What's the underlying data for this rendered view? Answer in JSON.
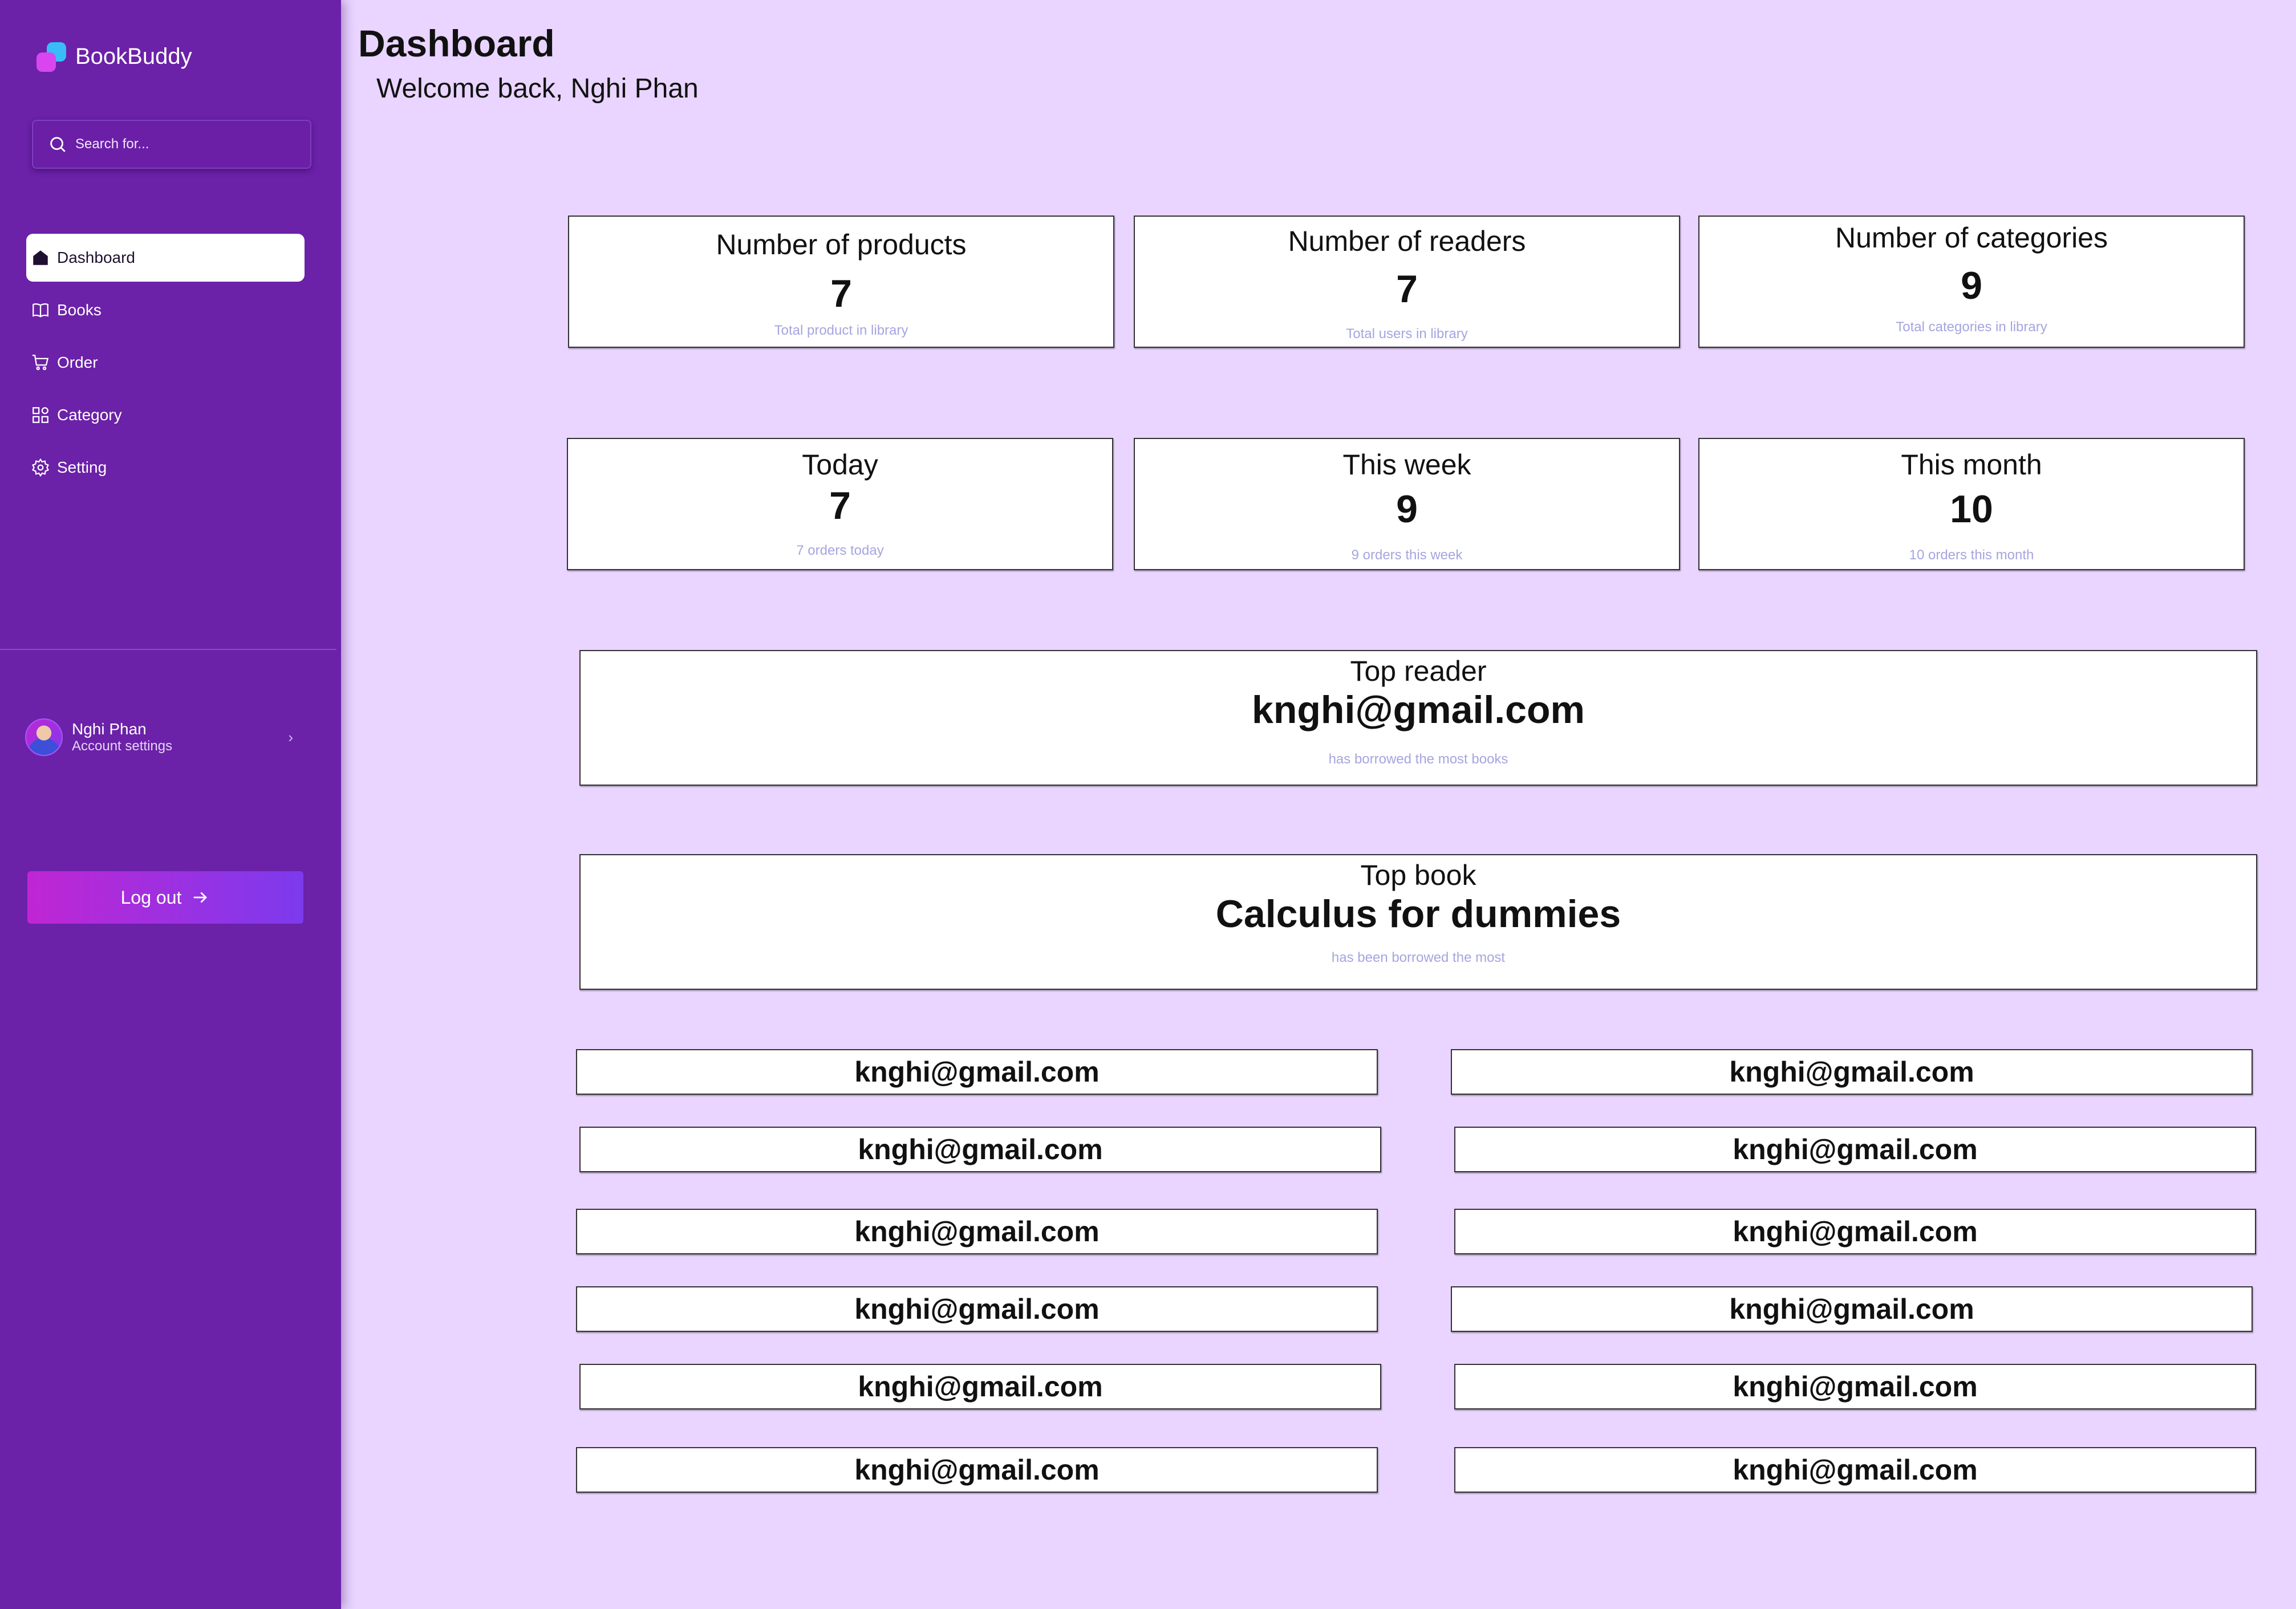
{
  "app": {
    "name": "BookBuddy"
  },
  "search": {
    "placeholder": "Search for..."
  },
  "nav": {
    "items": [
      {
        "label": "Dashboard",
        "icon": "home-icon",
        "active": true
      },
      {
        "label": "Books",
        "icon": "book-icon"
      },
      {
        "label": "Order",
        "icon": "cart-icon"
      },
      {
        "label": "Category",
        "icon": "grid-icon"
      },
      {
        "label": "Setting",
        "icon": "gear-icon"
      }
    ]
  },
  "profile": {
    "name": "Nghi Phan",
    "subtitle": "Account settings",
    "chevron": "›"
  },
  "logout": {
    "label": "Log out"
  },
  "header": {
    "title": "Dashboard",
    "welcome": "Welcome back, Nghi Phan"
  },
  "stats": [
    {
      "title": "Number of products",
      "value": "7",
      "sub": "Total product in library"
    },
    {
      "title": "Number of readers",
      "value": "7",
      "sub": "Total users in library"
    },
    {
      "title": "Number of  categories",
      "value": "9",
      "sub": "Total categories in library"
    }
  ],
  "orders": [
    {
      "title": "Today",
      "value": "7",
      "sub": "7 orders today"
    },
    {
      "title": "This week",
      "value": "9",
      "sub": "9 orders this week"
    },
    {
      "title": "This month",
      "value": "10",
      "sub": "10 orders this month"
    }
  ],
  "top_reader": {
    "title": "Top reader",
    "value": "knghi@gmail.com",
    "sub": "has borrowed the most books"
  },
  "top_book": {
    "title": "Top book",
    "value": "Calculus for dummies",
    "sub": "has been borrowed the most"
  },
  "emails": [
    "knghi@gmail.com",
    "knghi@gmail.com",
    "knghi@gmail.com",
    "knghi@gmail.com",
    "knghi@gmail.com",
    "knghi@gmail.com",
    "knghi@gmail.com",
    "knghi@gmail.com",
    "knghi@gmail.com",
    "knghi@gmail.com",
    "knghi@gmail.com",
    "knghi@gmail.com"
  ],
  "colors": {
    "sidebar": "#6b21a8",
    "background": "#e9d5ff",
    "accent_start": "#c026d3",
    "accent_end": "#7c3aed",
    "subtext": "#a5a5e0"
  }
}
